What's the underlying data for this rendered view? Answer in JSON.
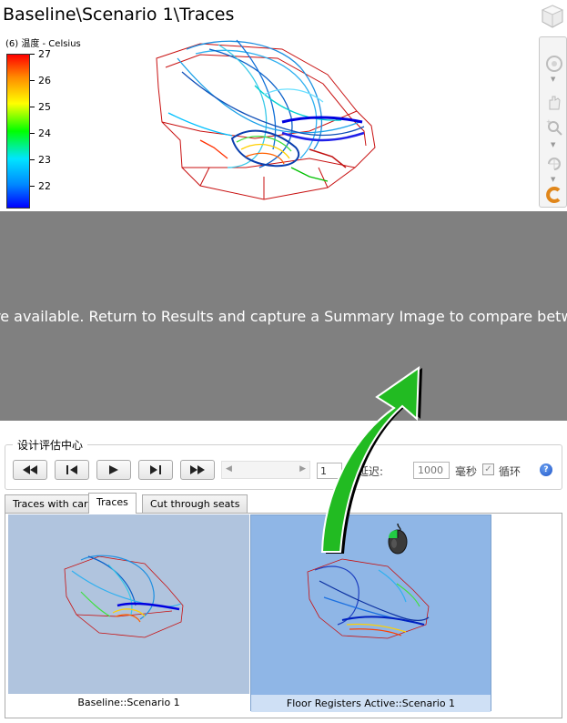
{
  "viewport": {
    "title": "Baseline\\Scenario 1\\Traces",
    "legend": {
      "title": "(6) 温度 - Celsius",
      "ticks": [
        "27",
        "26",
        "25",
        "24",
        "23",
        "22"
      ]
    },
    "icons": [
      "view-cube-icon",
      "orbit-icon",
      "pan-hand-icon",
      "zoom-icon",
      "rotate-icon",
      "c-logo-icon"
    ]
  },
  "message": "re available. Return to Results and capture a Summary Image to compare between desig",
  "decision_center": {
    "title": "设计评估中心",
    "player": {
      "buttons": [
        "rewind-start",
        "step-back",
        "play",
        "step-forward",
        "fast-forward"
      ],
      "frame_value": "1",
      "delay_label": "帧延迟:",
      "delay_value": "1000",
      "ms_label": "毫秒",
      "loop_label": "循环",
      "loop_checked": true
    },
    "tabs": [
      {
        "label": "Traces with car",
        "active": false
      },
      {
        "label": "Traces",
        "active": true
      },
      {
        "label": "Cut through seats",
        "active": false
      }
    ],
    "thumbnails": [
      {
        "caption": "Baseline::Scenario 1",
        "selected": false
      },
      {
        "caption": "Floor Registers Active::Scenario 1",
        "selected": true
      }
    ]
  },
  "colors": {
    "message_band": "#808080",
    "thumb_background": "#b0c4de",
    "thumb_selected_background": "#8fb6e6",
    "arrow_fill": "#22bb22"
  }
}
